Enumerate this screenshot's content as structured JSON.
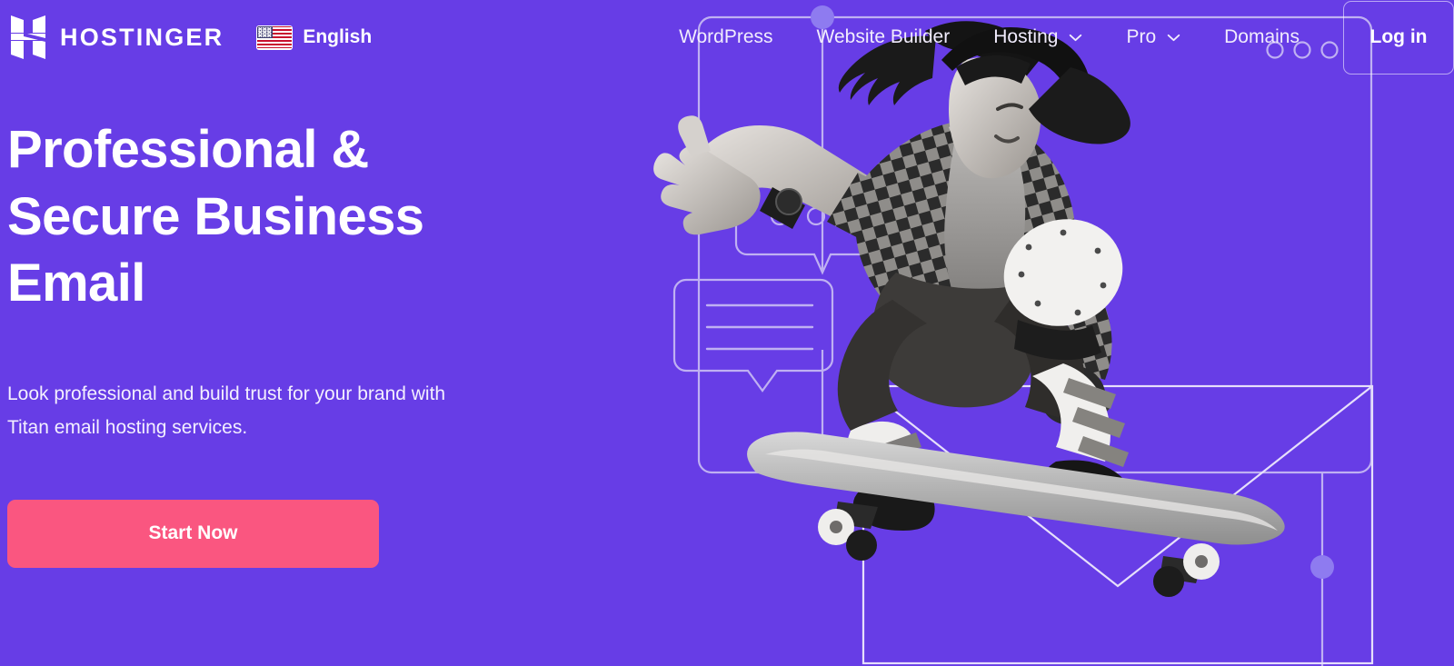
{
  "brand": {
    "logo_icon": "hostinger-h-logo-icon",
    "name": "HOSTINGER"
  },
  "language": {
    "flag_icon": "us-flag-icon",
    "label": "English"
  },
  "nav": {
    "items": [
      {
        "label": "WordPress",
        "has_dropdown": false
      },
      {
        "label": "Website Builder",
        "has_dropdown": false
      },
      {
        "label": "Hosting",
        "has_dropdown": true
      },
      {
        "label": "Pro",
        "has_dropdown": true
      },
      {
        "label": "Domains",
        "has_dropdown": false
      }
    ],
    "login_label": "Log in"
  },
  "hero": {
    "title": "Professional &\nSecure Business\nEmail",
    "subtitle": "Look professional and build trust for your brand with\nTitan email hosting services.",
    "cta_label": "Start Now"
  },
  "illustration": {
    "subject": "skateboarder",
    "window_dots": 3,
    "typing_bubble_dots": 3,
    "message_bubble_lines": 3,
    "envelope": true,
    "accent_dots": 2
  },
  "colors": {
    "background": "#673de6",
    "cta": "#fa5680",
    "text": "#ffffff",
    "outline": "#bfb0f2"
  }
}
